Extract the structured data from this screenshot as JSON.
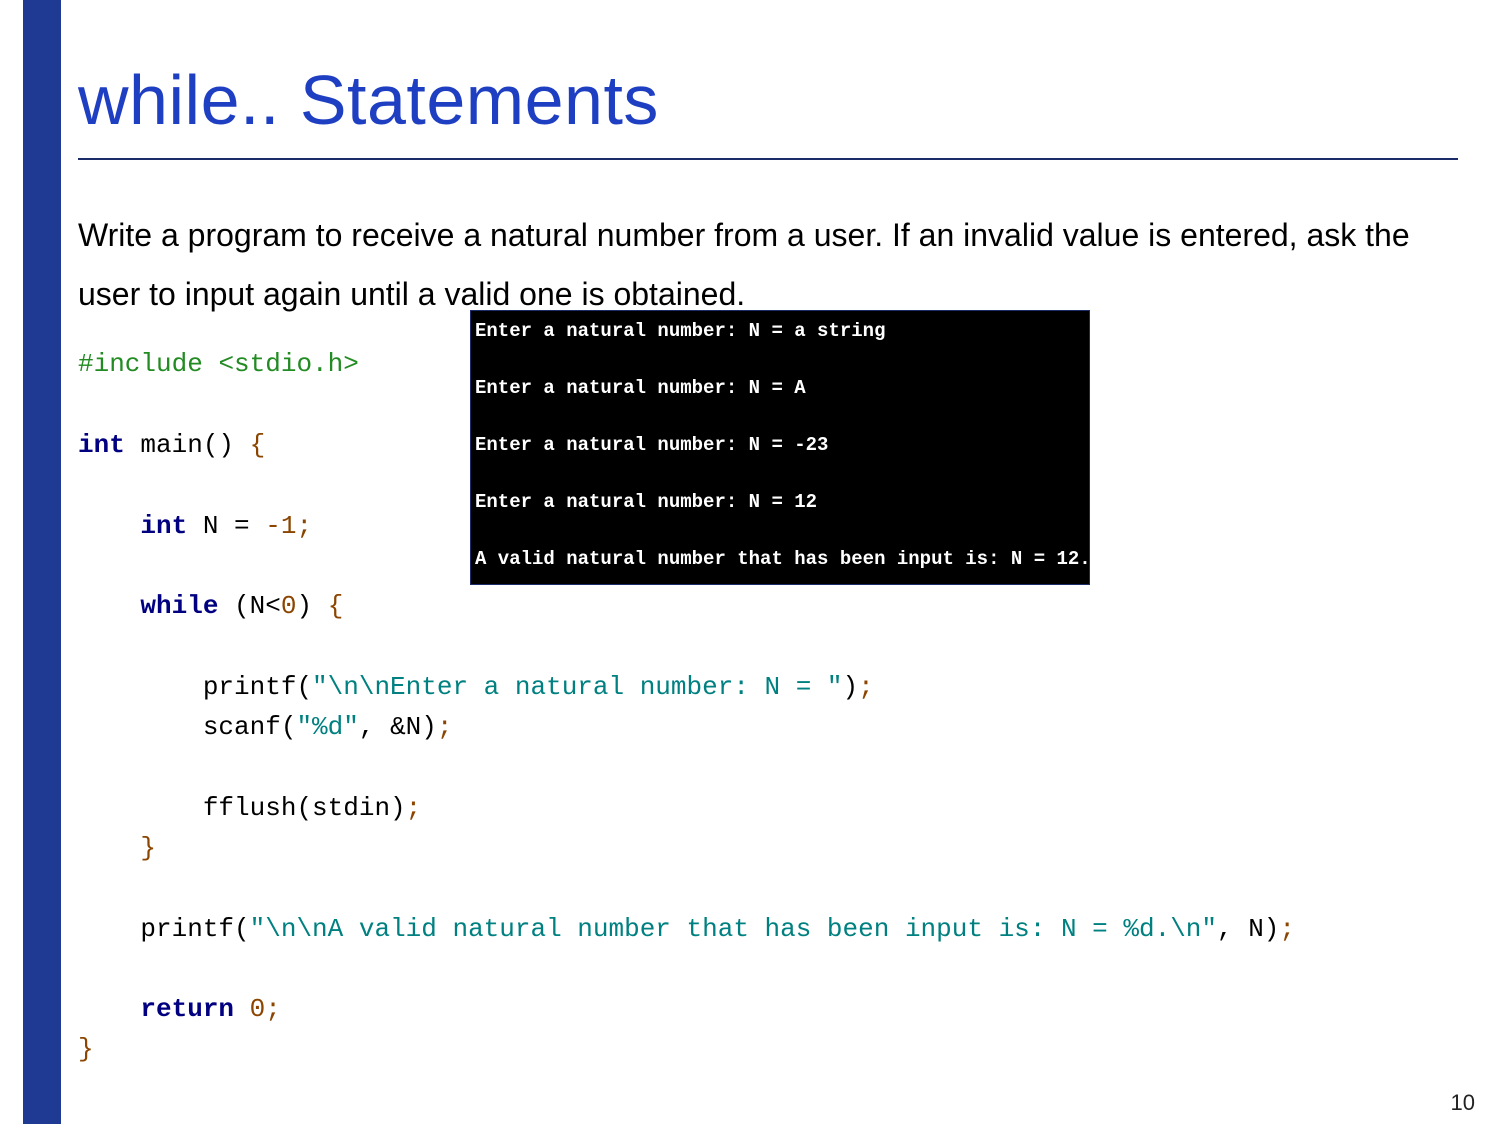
{
  "slide": {
    "title": "while.. Statements",
    "prompt": "Write a program to receive a natural number from a user. If an invalid value is entered, ask the user to input again until a valid one is obtained.",
    "page_number": "10"
  },
  "code": {
    "t_include": "#include ",
    "t_header": "<stdio.h>",
    "t_int1": "int",
    "t_main": " main() ",
    "t_lbrace1": "{",
    "t_int2": "int",
    "t_ndecl": " N = ",
    "t_neg1": "-1",
    "t_semi1": ";",
    "t_while": "while",
    "t_cond": " (N<",
    "t_zero": "0",
    "t_condend": ") ",
    "t_lbrace2": "{",
    "t_printf1": "printf(",
    "t_str1": "\"\\n\\nEnter a natural number: N = \"",
    "t_printfend1": ")",
    "t_semi2": ";",
    "t_scanf": "scanf(",
    "t_str2": "\"%d\"",
    "t_scanfrest": ", &N)",
    "t_semi3": ";",
    "t_fflush": "fflush(stdin)",
    "t_semi4": ";",
    "t_rbrace2": "}",
    "t_printf2": "printf(",
    "t_str3": "\"\\n\\nA valid natural number that has been input is: N = %d.\\n\"",
    "t_printf2rest": ", N)",
    "t_semi5": ";",
    "t_return": "return",
    "t_retval": " 0",
    "t_semi6": ";",
    "t_rbrace1": "}"
  },
  "console": {
    "line1": "Enter a natural number: N = a string",
    "line2": "Enter a natural number: N = A",
    "line3": "Enter a natural number: N = -23",
    "line4": "Enter a natural number: N = 12",
    "line5": "A valid natural number that has been input is: N = 12."
  }
}
